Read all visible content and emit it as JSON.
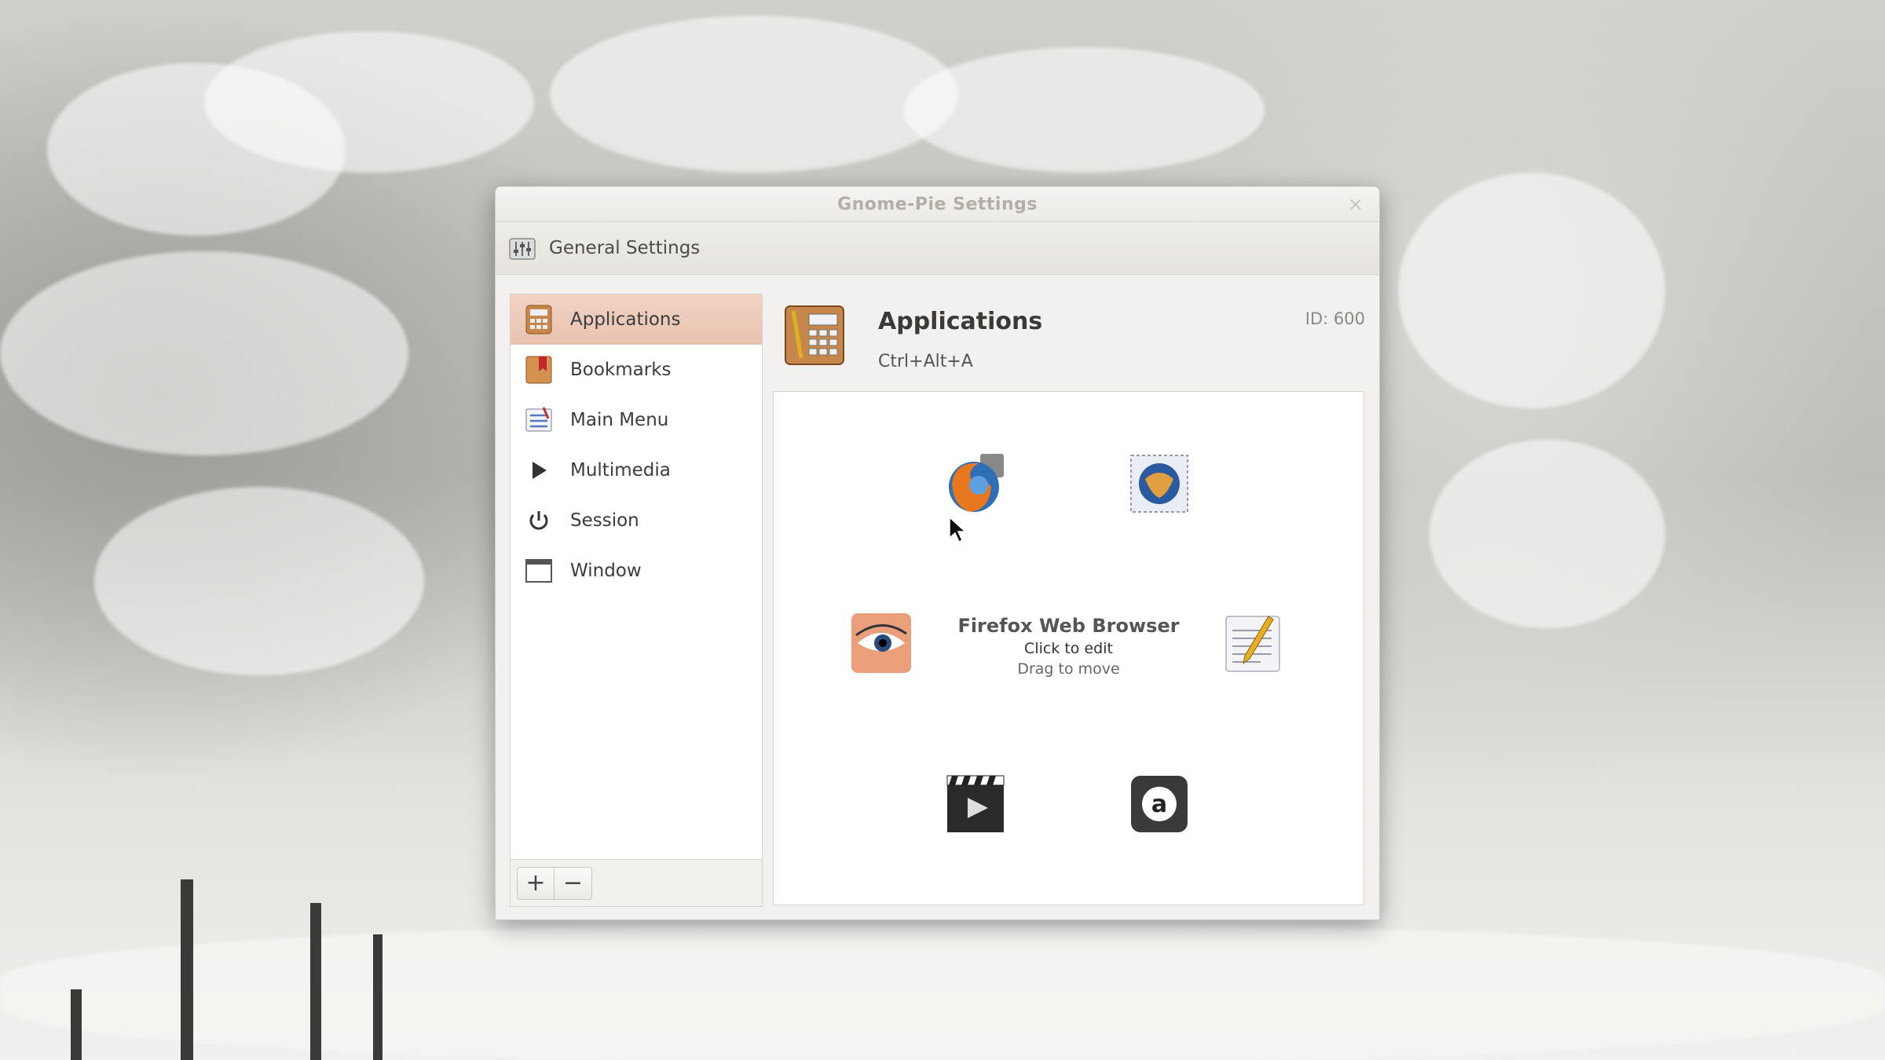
{
  "window": {
    "title": "Gnome-Pie Settings",
    "close_glyph": "×"
  },
  "toolbar": {
    "general_settings_label": "General Settings",
    "general_settings_icon": "sliders-icon"
  },
  "sidebar": {
    "items": [
      {
        "label": "Applications",
        "icon": "calculator-icon",
        "selected": true
      },
      {
        "label": "Bookmarks",
        "icon": "bookmark-icon",
        "selected": false
      },
      {
        "label": "Main Menu",
        "icon": "menu-icon",
        "selected": false
      },
      {
        "label": "Multimedia",
        "icon": "play-icon",
        "selected": false
      },
      {
        "label": "Session",
        "icon": "power-icon",
        "selected": false
      },
      {
        "label": "Window",
        "icon": "window-icon",
        "selected": false
      }
    ],
    "add_label": "+",
    "remove_label": "−"
  },
  "pie": {
    "name": "Applications",
    "hotkey": "Ctrl+Alt+A",
    "id_label": "ID: 600"
  },
  "preview": {
    "center_name": "Firefox Web Browser",
    "hint_edit": "Click to edit",
    "hint_move": "Drag to move",
    "slices": [
      {
        "icon": "firefox-icon"
      },
      {
        "icon": "thunderbird-icon"
      },
      {
        "icon": "eye-icon"
      },
      {
        "icon": "text-editor-icon"
      },
      {
        "icon": "video-player-icon"
      },
      {
        "icon": "amazon-icon"
      }
    ]
  },
  "colors": {
    "selected_row": "#e8c2b0",
    "window_bg": "#f2f1ef"
  }
}
